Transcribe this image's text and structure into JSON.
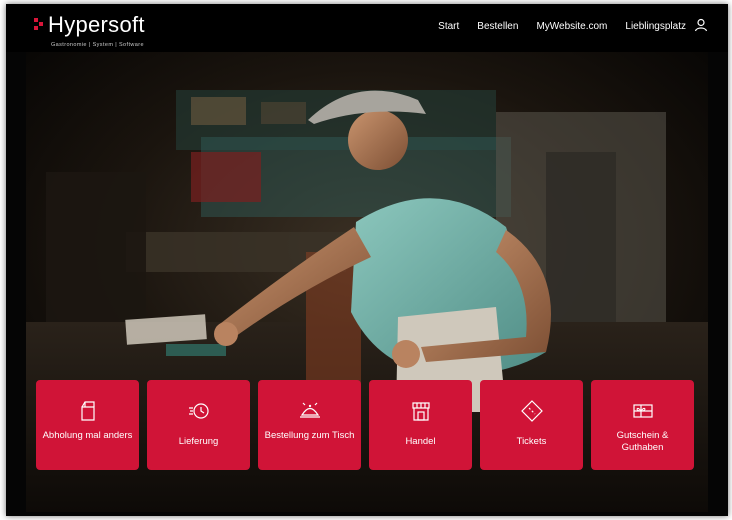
{
  "brand": {
    "name": "Hypersoft",
    "tagline": "Gastronomie | System | Software",
    "accent_color": "#d01437"
  },
  "nav": {
    "items": [
      "Start",
      "Bestellen",
      "MyWebsite.com",
      "Lieblingsplatz"
    ],
    "user_icon": "user-icon"
  },
  "hero": {
    "image": "pizza-chef-photo"
  },
  "tiles": [
    {
      "label": "Abholung mal anders",
      "icon": "bag-icon"
    },
    {
      "label": "Lieferung",
      "icon": "delivery-clock-icon"
    },
    {
      "label": "Bestellung zum Tisch",
      "icon": "cloche-icon"
    },
    {
      "label": "Handel",
      "icon": "shop-icon"
    },
    {
      "label": "Tickets",
      "icon": "ticket-icon"
    },
    {
      "label": "Gutschein & Guthaben",
      "icon": "gift-card-icon"
    }
  ]
}
